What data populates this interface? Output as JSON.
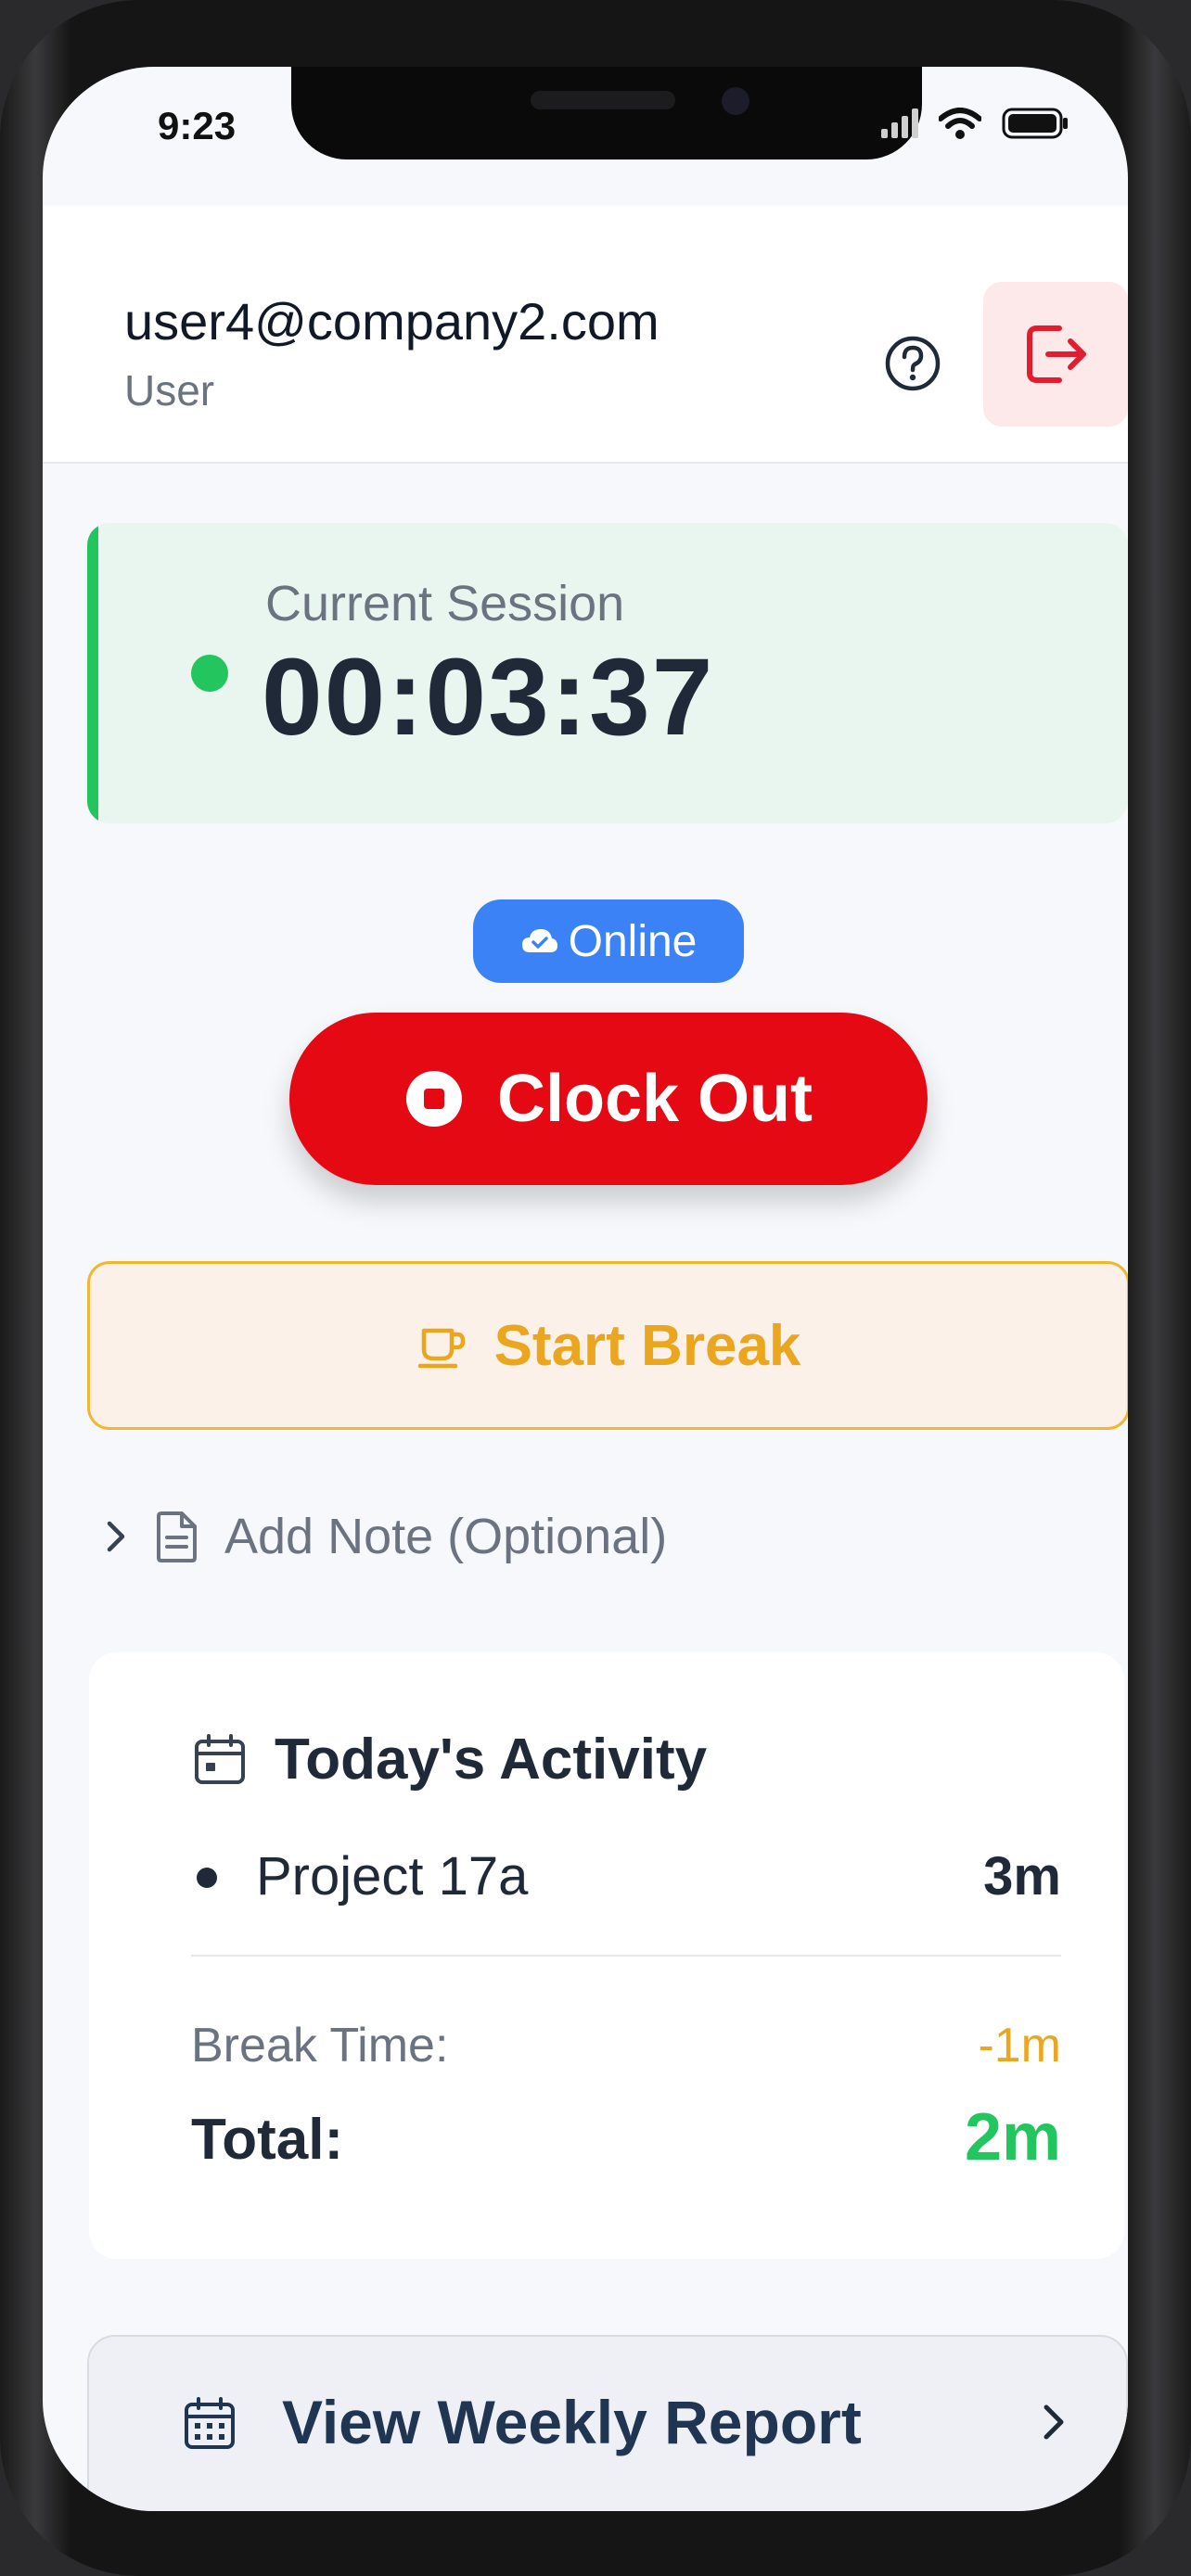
{
  "status_bar": {
    "time": "9:23"
  },
  "header": {
    "email": "user4@company2.com",
    "role": "User"
  },
  "session": {
    "label": "Current Session",
    "timer": "00:03:37"
  },
  "connection": {
    "status": "Online"
  },
  "actions": {
    "clock_out_label": "Clock Out",
    "start_break_label": "Start Break"
  },
  "note": {
    "label": "Add Note (Optional)"
  },
  "activity": {
    "title": "Today's Activity",
    "projects": [
      {
        "name": "Project 17a",
        "duration": "3m"
      }
    ],
    "break_label": "Break Time:",
    "break_value": "-1m",
    "total_label": "Total:",
    "total_value": "2m"
  },
  "weekly_report": {
    "label": "View Weekly Report"
  },
  "icons": {
    "help": "help-circle-icon",
    "logout": "logout-icon",
    "status_dot": "status-dot-icon",
    "cloud": "cloud-check-icon",
    "stop": "stop-icon",
    "coffee": "coffee-cup-icon",
    "chevron_right": "chevron-right-icon",
    "document": "document-icon",
    "calendar": "calendar-icon",
    "signal": "signal-icon",
    "wifi": "wifi-icon",
    "battery": "battery-icon"
  },
  "colors": {
    "accent_green": "#22c55e",
    "danger_red": "#e50914",
    "warning_amber": "#eaa61f",
    "online_blue": "#3b82f6",
    "text_dark": "#1f2937",
    "text_muted": "#6b7280"
  }
}
